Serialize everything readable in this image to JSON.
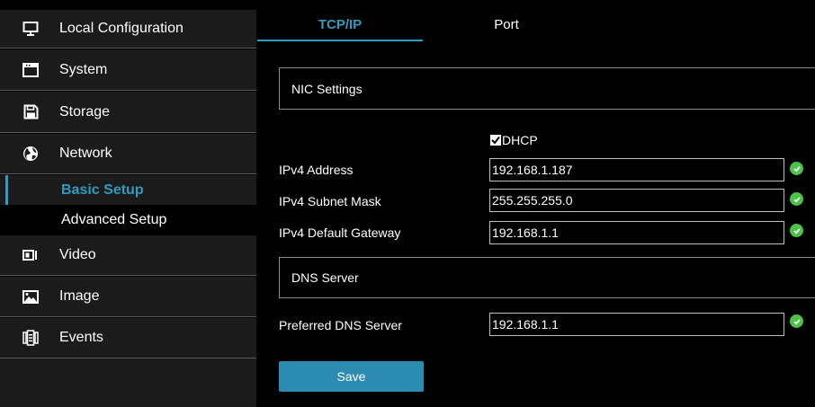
{
  "sidebar": {
    "items": [
      {
        "label": "Local Configuration",
        "icon": "monitor-icon"
      },
      {
        "label": "System",
        "icon": "system-window-icon"
      },
      {
        "label": "Storage",
        "icon": "save-disk-icon"
      },
      {
        "label": "Network",
        "icon": "globe-icon"
      },
      {
        "label": "Video",
        "icon": "video-camera-icon"
      },
      {
        "label": "Image",
        "icon": "image-icon"
      },
      {
        "label": "Events",
        "icon": "events-list-icon"
      }
    ],
    "network_sub": [
      {
        "label": "Basic Setup",
        "active": true
      },
      {
        "label": "Advanced Setup",
        "active": false
      }
    ]
  },
  "tabs": [
    {
      "label": "TCP/IP",
      "active": true
    },
    {
      "label": "Port",
      "active": false
    }
  ],
  "nic_section": {
    "label": "NIC Settings"
  },
  "dhcp": {
    "label": "DHCP",
    "checked": true
  },
  "fields": {
    "ipv4_address": {
      "label": "IPv4 Address",
      "value": "192.168.1.187"
    },
    "ipv4_subnet": {
      "label": "IPv4 Subnet Mask",
      "value": "255.255.255.0"
    },
    "ipv4_gateway": {
      "label": "IPv4 Default Gateway",
      "value": "192.168.1.1"
    },
    "preferred_dns": {
      "label": "Preferred DNS Server",
      "value": "192.168.1.1"
    }
  },
  "dns_section": {
    "label": "DNS Server"
  },
  "save_label": "Save",
  "colors": {
    "accent": "#2f9bc0",
    "button": "#2b8bb0",
    "valid": "#4cc24a",
    "sidebar_bg": "#1b1b1b"
  }
}
